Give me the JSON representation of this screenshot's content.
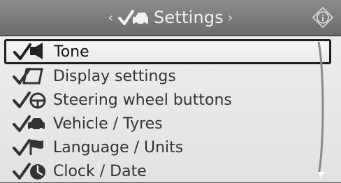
{
  "header": {
    "title": "Settings",
    "nav_left": "‹",
    "nav_right": "›",
    "title_icon": "car-check-icon",
    "info_icon": "info-icon"
  },
  "menu": {
    "items": [
      {
        "label": "Tone",
        "icon": "tone-icon",
        "selected": true
      },
      {
        "label": "Display settings",
        "icon": "display-icon",
        "selected": false
      },
      {
        "label": "Steering wheel buttons",
        "icon": "steering-wheel-icon",
        "selected": false
      },
      {
        "label": "Vehicle / Tyres",
        "icon": "vehicle-icon",
        "selected": false
      },
      {
        "label": "Language / Units",
        "icon": "flag-icon",
        "selected": false
      },
      {
        "label": "Clock / Date",
        "icon": "clock-icon",
        "selected": false
      }
    ]
  },
  "colors": {
    "header_bg": "#777777",
    "menu_bg": "#eeeeee",
    "text": "#333333",
    "selection_border": "#1f1f1f"
  }
}
